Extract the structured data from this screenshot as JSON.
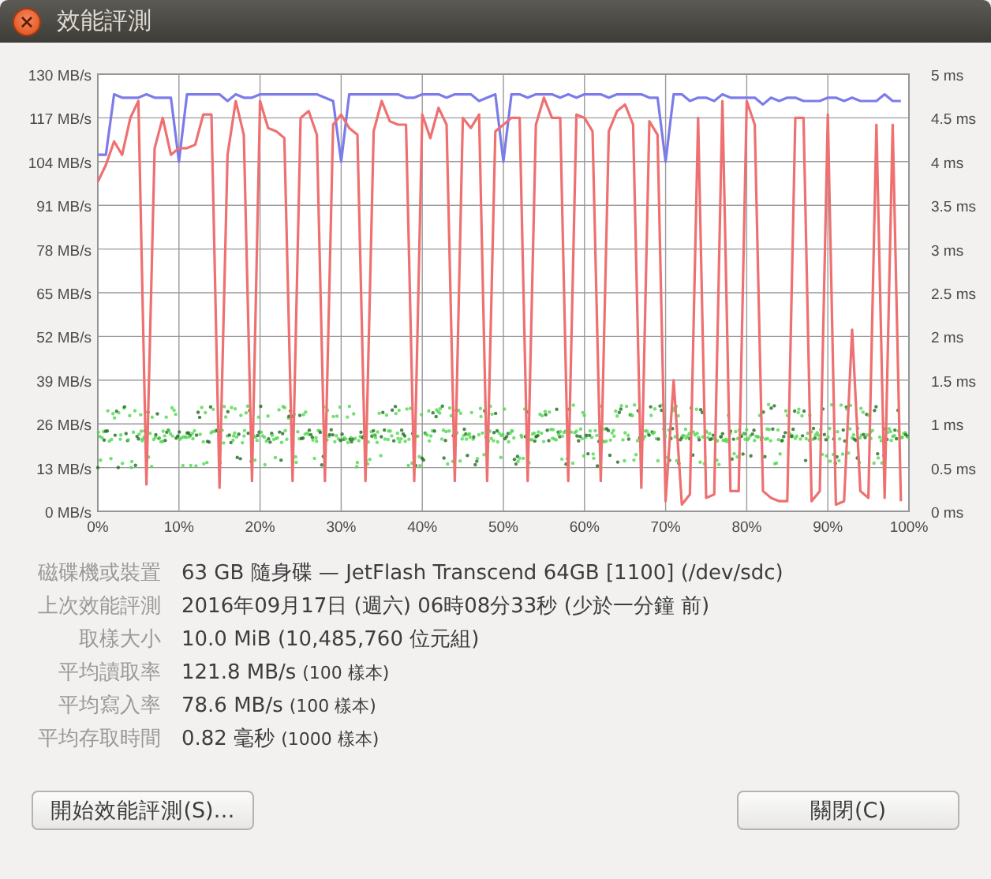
{
  "window": {
    "title": "效能評測"
  },
  "chart_data": {
    "type": "line",
    "grid": true,
    "x": [
      0,
      1,
      2,
      3,
      4,
      5,
      6,
      7,
      8,
      9,
      10,
      11,
      12,
      13,
      14,
      15,
      16,
      17,
      18,
      19,
      20,
      21,
      22,
      23,
      24,
      25,
      26,
      27,
      28,
      29,
      30,
      31,
      32,
      33,
      34,
      35,
      36,
      37,
      38,
      39,
      40,
      41,
      42,
      43,
      44,
      45,
      46,
      47,
      48,
      49,
      50,
      51,
      52,
      53,
      54,
      55,
      56,
      57,
      58,
      59,
      60,
      61,
      62,
      63,
      64,
      65,
      66,
      67,
      68,
      69,
      70,
      71,
      72,
      73,
      74,
      75,
      76,
      77,
      78,
      79,
      80,
      81,
      82,
      83,
      84,
      85,
      86,
      87,
      88,
      89,
      90,
      91,
      92,
      93,
      94,
      95,
      96,
      97,
      98,
      99
    ],
    "xlim": [
      0,
      100
    ],
    "ylim": [
      0,
      130
    ],
    "y2lim": [
      0,
      5
    ],
    "xticks": [
      {
        "value": 0,
        "label": "0%"
      },
      {
        "value": 10,
        "label": "10%"
      },
      {
        "value": 20,
        "label": "20%"
      },
      {
        "value": 30,
        "label": "30%"
      },
      {
        "value": 40,
        "label": "40%"
      },
      {
        "value": 50,
        "label": "50%"
      },
      {
        "value": 60,
        "label": "60%"
      },
      {
        "value": 70,
        "label": "70%"
      },
      {
        "value": 80,
        "label": "80%"
      },
      {
        "value": 90,
        "label": "90%"
      },
      {
        "value": 100,
        "label": "100%"
      }
    ],
    "yticks": [
      {
        "value": 0,
        "label": "0 MB/s"
      },
      {
        "value": 13,
        "label": "13 MB/s"
      },
      {
        "value": 26,
        "label": "26 MB/s"
      },
      {
        "value": 39,
        "label": "39 MB/s"
      },
      {
        "value": 52,
        "label": "52 MB/s"
      },
      {
        "value": 65,
        "label": "65 MB/s"
      },
      {
        "value": 78,
        "label": "78 MB/s"
      },
      {
        "value": 91,
        "label": "91 MB/s"
      },
      {
        "value": 104,
        "label": "104 MB/s"
      },
      {
        "value": 117,
        "label": "117 MB/s"
      },
      {
        "value": 130,
        "label": "130 MB/s"
      }
    ],
    "y2ticks": [
      {
        "value": 0,
        "label": "0 ms"
      },
      {
        "value": 0.5,
        "label": "0.5 ms"
      },
      {
        "value": 1,
        "label": "1 ms"
      },
      {
        "value": 1.5,
        "label": "1.5 ms"
      },
      {
        "value": 2,
        "label": "2 ms"
      },
      {
        "value": 2.5,
        "label": "2.5 ms"
      },
      {
        "value": 3,
        "label": "3 ms"
      },
      {
        "value": 3.5,
        "label": "3.5 ms"
      },
      {
        "value": 4,
        "label": "4 ms"
      },
      {
        "value": 4.5,
        "label": "4.5 ms"
      },
      {
        "value": 5,
        "label": "5 ms"
      }
    ],
    "series": [
      {
        "color": "#7b7bea",
        "values": [
          106,
          106,
          124,
          123,
          123,
          123,
          124,
          123,
          123,
          123,
          104,
          124,
          124,
          124,
          124,
          124,
          122,
          124,
          123,
          123,
          124,
          124,
          124,
          124,
          124,
          124,
          124,
          124,
          123,
          122,
          104,
          124,
          124,
          124,
          124,
          124,
          124,
          124,
          123,
          123,
          124,
          124,
          124,
          123,
          124,
          124,
          124,
          122,
          123,
          124,
          104,
          124,
          124,
          123,
          124,
          124,
          124,
          123,
          124,
          123,
          124,
          124,
          124,
          123,
          124,
          124,
          124,
          124,
          123,
          123,
          104,
          124,
          124,
          122,
          123,
          123,
          122,
          124,
          123,
          123,
          123,
          123,
          121,
          123,
          122,
          123,
          123,
          122,
          122,
          122,
          123,
          123,
          122,
          123,
          122,
          122,
          122,
          124,
          122,
          122
        ]
      },
      {
        "color": "#ee7070",
        "values": [
          98,
          103,
          110,
          106,
          117,
          122,
          8,
          108,
          117,
          106,
          108,
          108,
          109,
          118,
          118,
          7,
          106,
          122,
          112,
          9,
          122,
          114,
          113,
          111,
          9,
          117,
          119,
          112,
          9,
          115,
          118,
          114,
          112,
          9,
          113,
          122,
          116,
          115,
          115,
          9,
          118,
          111,
          120,
          115,
          9,
          117,
          114,
          118,
          9,
          113,
          115,
          117,
          117,
          9,
          115,
          123,
          117,
          117,
          9,
          118,
          117,
          113,
          9,
          113,
          119,
          121,
          115,
          7,
          116,
          112,
          3,
          39,
          2,
          5,
          117,
          4,
          5,
          122,
          6,
          6,
          122,
          115,
          6,
          4,
          3,
          3,
          117,
          117,
          3,
          6,
          118,
          2,
          3,
          54,
          6,
          4,
          115,
          4,
          115,
          3
        ]
      }
    ]
  },
  "details": [
    {
      "label": "磁碟機或裝置",
      "value": "63 GB 隨身碟 — JetFlash Transcend 64GB [1100] (/dev/sdc)"
    },
    {
      "label": "上次效能評測",
      "value": "2016年09月17日 (週六) 06時08分33秒 (少於一分鐘 前)"
    },
    {
      "label": "取樣大小",
      "value": "10.0 MiB (10,485,760 位元組)"
    },
    {
      "label": "平均讀取率",
      "value": "121.8 MB/s",
      "note": "(100 樣本)"
    },
    {
      "label": "平均寫入率",
      "value": "78.6 MB/s",
      "note": "(100 樣本)"
    },
    {
      "label": "平均存取時間",
      "value": "0.82 毫秒",
      "note": "(1000 樣本)"
    }
  ],
  "buttons": {
    "start": "開始效能評測(S)…",
    "close": "關閉(C)"
  }
}
